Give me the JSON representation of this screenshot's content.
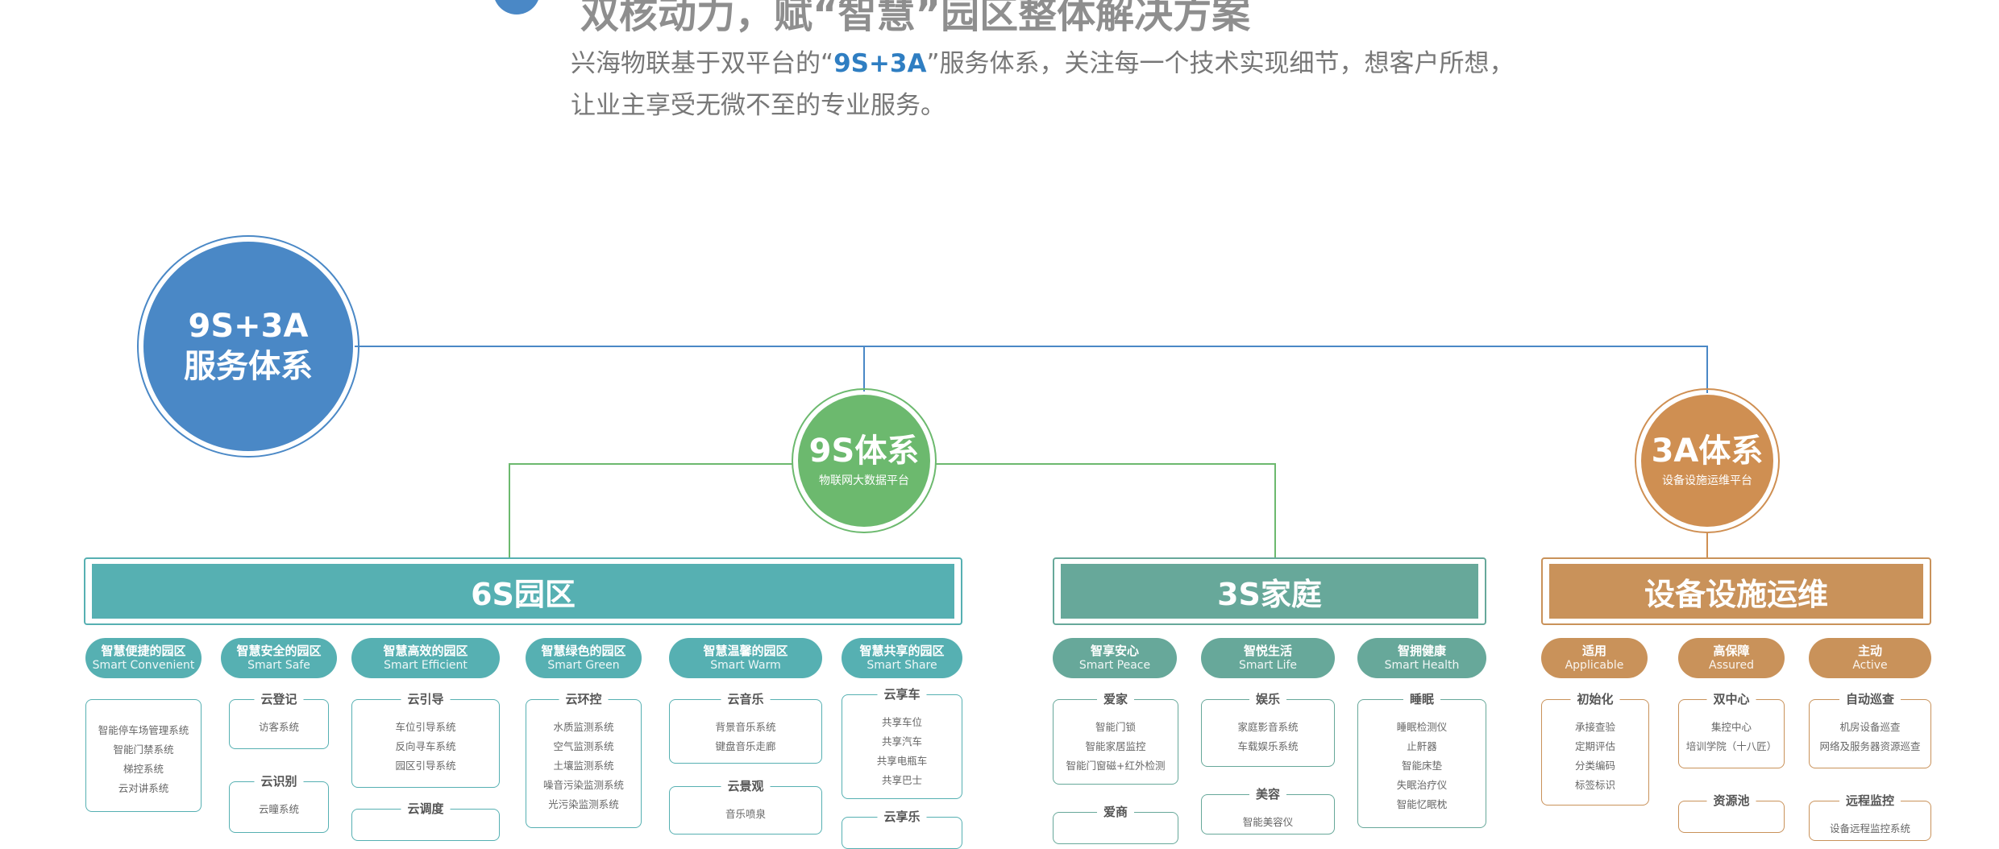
{
  "header": {
    "title": "双核动力，赋“智慧”园区整体解决方案",
    "intro_line1_pre": "兴海物联基于双平台的“",
    "intro_highlight": "9S+3A",
    "intro_line1_post": "”服务体系，关注每一个技术实现细节，想客户所想，",
    "intro_line2": "让业主享受无微不至的专业服务。"
  },
  "colors": {
    "blue": "#4a88c6",
    "green": "#6cb96e",
    "orange": "#cf8f52",
    "teal_6s": "#56b0b2",
    "teal_3s": "#67a89a",
    "brown_ops": "#c9925a"
  },
  "root": {
    "line1": "9S+3A",
    "line2": "服务体系"
  },
  "node_9s": {
    "title": "9S体系",
    "subtitle": "物联网大数据平台"
  },
  "node_3a": {
    "title": "3A体系",
    "subtitle": "设备设施运维平台"
  },
  "sections": {
    "s6": "6S园区",
    "s3": "3S家庭",
    "ops": "设备设施运维"
  },
  "pills_6s": [
    {
      "zh": "智慧便捷的园区",
      "en": "Smart  Convenient"
    },
    {
      "zh": "智慧安全的园区",
      "en": "Smart  Safe"
    },
    {
      "zh": "智慧高效的园区",
      "en": "Smart Efficient"
    },
    {
      "zh": "智慧绿色的园区",
      "en": "Smart Green"
    },
    {
      "zh": "智慧温馨的园区",
      "en": "Smart Warm"
    },
    {
      "zh": "智慧共享的园区",
      "en": "Smart Share"
    }
  ],
  "pills_3s": [
    {
      "zh": "智享安心",
      "en": "Smart Peace"
    },
    {
      "zh": "智悦生活",
      "en": "Smart Life"
    },
    {
      "zh": "智拥健康",
      "en": "Smart Health"
    }
  ],
  "pills_ops": [
    {
      "zh": "适用",
      "en": "Applicable"
    },
    {
      "zh": "高保障",
      "en": "Assured"
    },
    {
      "zh": "主动",
      "en": "Active"
    }
  ],
  "boxes_6s": [
    {
      "title": "",
      "items": [
        "智能停车场管理系统",
        "智能门禁系统",
        "梯控系统",
        "云对讲系统"
      ]
    },
    {
      "title": "云登记",
      "items": [
        "访客系统"
      ]
    },
    {
      "title": "云识别",
      "items": [
        "云瞳系统"
      ]
    },
    {
      "title": "云引导",
      "items": [
        "车位引导系统",
        "反向寻车系统",
        "园区引导系统"
      ]
    },
    {
      "title": "云调度",
      "items": []
    },
    {
      "title": "云环控",
      "items": [
        "水质监测系统",
        "空气监测系统",
        "土壤监测系统",
        "噪音污染监测系统",
        "光污染监测系统"
      ]
    },
    {
      "title": "云音乐",
      "items": [
        "背景音乐系统",
        "键盘音乐走廊"
      ]
    },
    {
      "title": "云景观",
      "items": [
        "音乐喷泉"
      ]
    },
    {
      "title": "云享车",
      "items": [
        "共享车位",
        "共享汽车",
        "共享电瓶车",
        "共享巴士"
      ]
    },
    {
      "title": "云享乐",
      "items": []
    }
  ],
  "boxes_3s": [
    {
      "title": "爱家",
      "items": [
        "智能门锁",
        "智能家居监控",
        "智能门窗磁+红外检测"
      ]
    },
    {
      "title": "爱商",
      "items": []
    },
    {
      "title": "娱乐",
      "items": [
        "家庭影音系统",
        "车载娱乐系统"
      ]
    },
    {
      "title": "美容",
      "items": [
        "智能美容仪"
      ]
    },
    {
      "title": "睡眠",
      "items": [
        "睡眠检测仪",
        "止鼾器",
        "智能床垫",
        "失眠治疗仪",
        "智能忆眠枕"
      ]
    }
  ],
  "boxes_ops": [
    {
      "title": "初始化",
      "items": [
        "承接查验",
        "定期评估",
        "分类编码",
        "标签标识"
      ]
    },
    {
      "title": "双中心",
      "items": [
        "集控中心",
        "培训学院（十八匠）"
      ]
    },
    {
      "title": "资源池",
      "items": []
    },
    {
      "title": "自动巡查",
      "items": [
        "机房设备巡查",
        "网络及服务器资源巡查"
      ]
    },
    {
      "title": "远程监控",
      "items": [
        "设备远程监控系统"
      ]
    }
  ]
}
